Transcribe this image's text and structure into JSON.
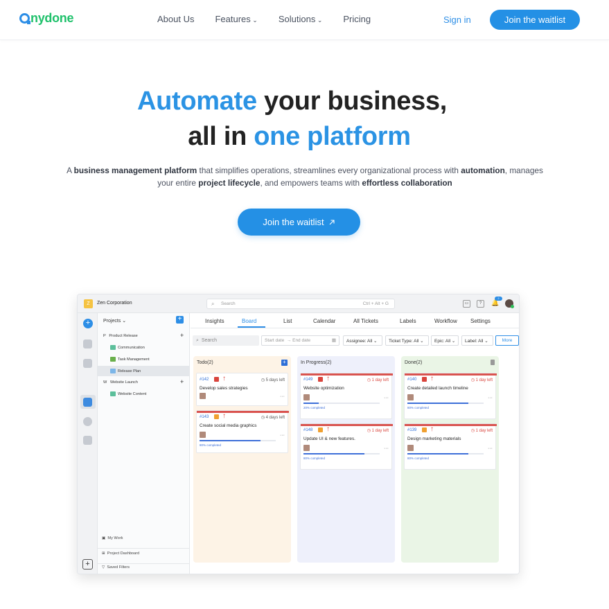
{
  "nav": {
    "logo_o": "o",
    "logo_rest": "nydone",
    "links": [
      "About Us",
      "Features",
      "Solutions",
      "Pricing"
    ],
    "signin": "Sign in",
    "join": "Join the waitlist"
  },
  "hero": {
    "line1_blue": "Automate",
    "line1_rest": " your business,",
    "line2_start": "all in ",
    "line2_blue": "one platform",
    "sub_parts": [
      "A ",
      "business management platform",
      " that simplifies operations, streamlines every organizational process with ",
      "automation",
      ", manages",
      "your entire ",
      "project lifecycle",
      ", and empowers teams with ",
      "effortless collaboration"
    ],
    "cta": "Join the waitlist",
    "cta_icon": "arrow-up-right-icon"
  },
  "app": {
    "org_initial": "Z",
    "org": "Zen Corporation",
    "search": "Search",
    "shortcut": "Ctrl + Alt + G",
    "notif_count": "2",
    "sidebar": {
      "projects": "Projects",
      "tree": [
        {
          "prefix": "P",
          "label": "Product Release"
        },
        {
          "label": "Communication"
        },
        {
          "label": "Task Management"
        },
        {
          "label": "Release Plan"
        },
        {
          "prefix": "W",
          "label": "Website Launch"
        },
        {
          "label": "Website Content"
        }
      ],
      "footer": [
        "My Work",
        "Project Dashboard",
        "Saved Filters"
      ]
    },
    "tabs": [
      "Insights",
      "Board",
      "List",
      "Calendar",
      "All Tickets",
      "Labels",
      "Workflow",
      "Settings"
    ],
    "active_tab": "Board",
    "filters": {
      "search": "Search",
      "start": "Start date",
      "end": "End date",
      "assignee": "Assignee:  All",
      "ticket_type": "Ticket Type:  All",
      "epic": "Epic:  All",
      "label": "Label:  All",
      "more": "More"
    },
    "columns": [
      {
        "title": "Todo(2)",
        "bg": "#fdf3e6",
        "cards": [
          {
            "id": "#142",
            "title": "Develop sales strategies",
            "due": "5 days left",
            "due_color": "#555555",
            "priority_color": "#d9443c",
            "progress": null,
            "progress_label": null
          },
          {
            "id": "#143",
            "title": "Create social media graphics",
            "due": "4 days left",
            "due_color": "#555555",
            "priority_color": "#f0a030",
            "progress": 0.8,
            "progress_label": "80% completed"
          }
        ]
      },
      {
        "title": "In Progress(2)",
        "bg": "#eef0fb",
        "cards": [
          {
            "id": "#149",
            "title": "Website optimization",
            "due": "1 day left",
            "due_color": "#d9443c",
            "priority_color": "#d9443c",
            "progress": 0.2,
            "progress_label": "20% completed"
          },
          {
            "id": "#148",
            "title": "Update UI & new features.",
            "due": "1 day left",
            "due_color": "#d9443c",
            "priority_color": "#f0a030",
            "progress": 0.8,
            "progress_label": "80% completed"
          }
        ]
      },
      {
        "title": "Done(2)",
        "bg": "#eaf5e6",
        "cards": [
          {
            "id": "#140",
            "title": "Create detailed launch timeline",
            "due": "1 day left",
            "due_color": "#d9443c",
            "priority_color": "#d9443c",
            "progress": 0.8,
            "progress_label": "80% completed"
          },
          {
            "id": "#139",
            "title": "Design marketing materials",
            "due": "1 day left",
            "due_color": "#d9443c",
            "priority_color": "#f0a030",
            "progress": 0.8,
            "progress_label": "80% completed"
          }
        ]
      }
    ]
  }
}
